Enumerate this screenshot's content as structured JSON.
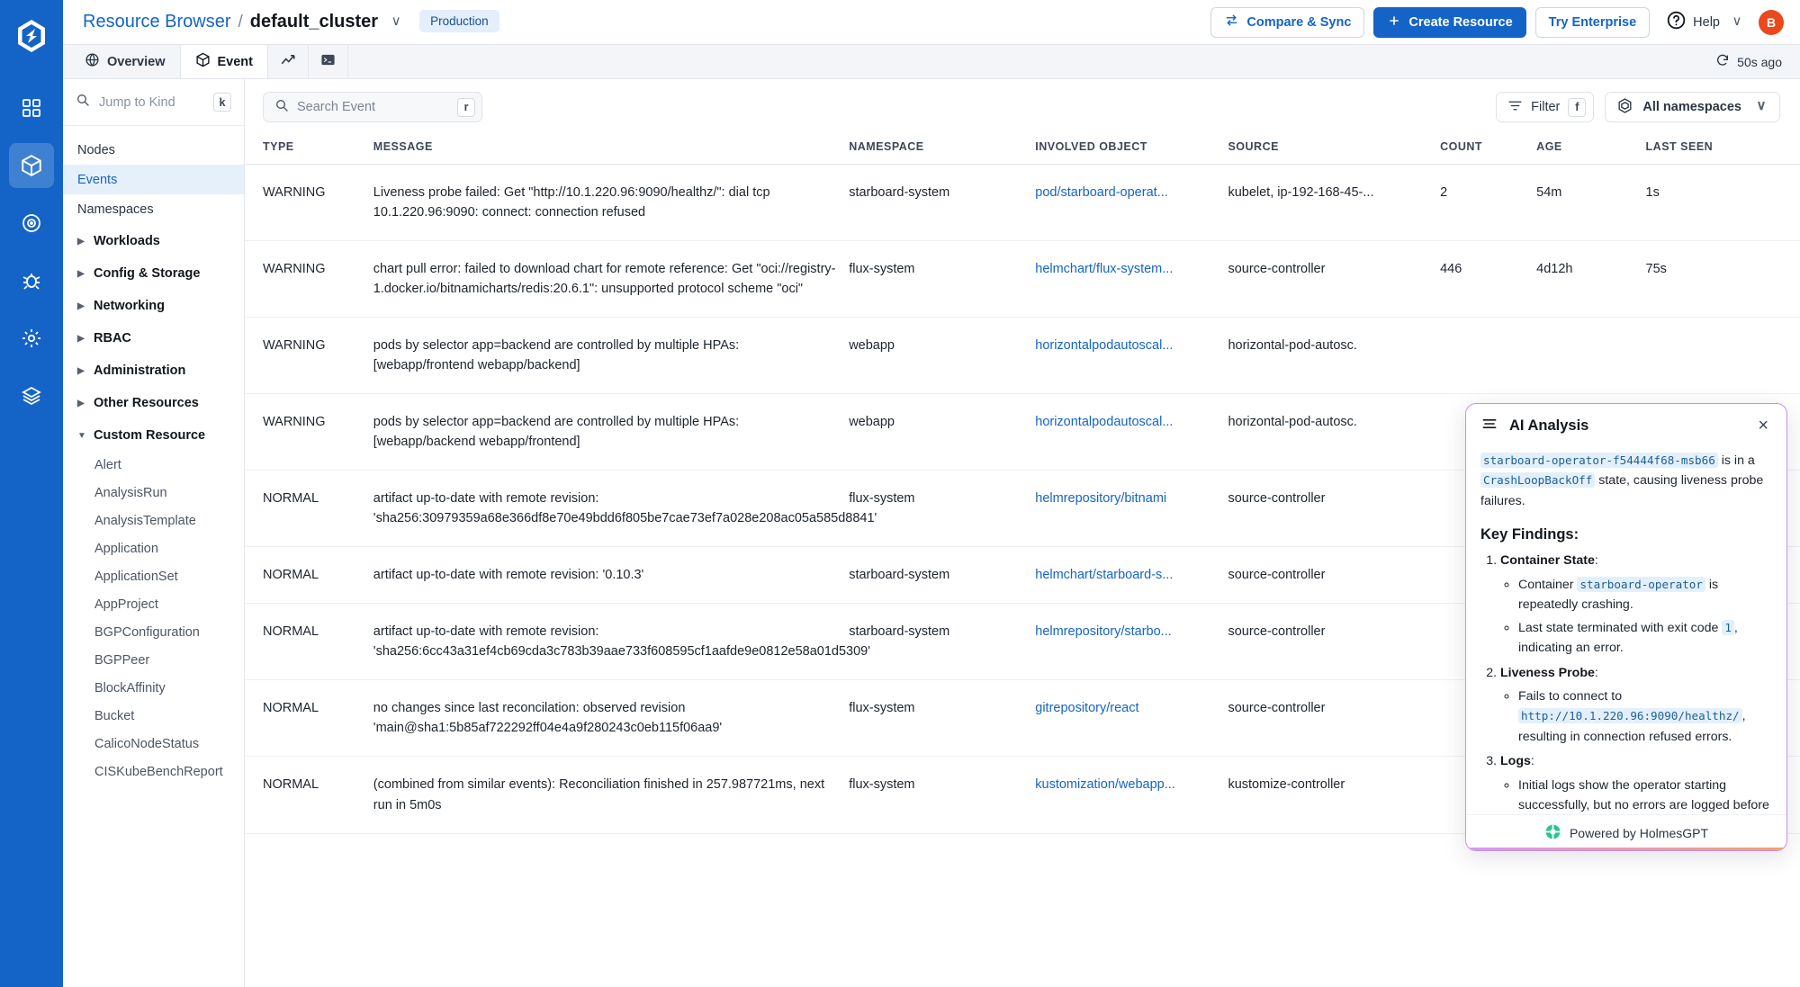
{
  "rail": {
    "logo_icon": "hexagon-logo-icon",
    "items": [
      {
        "name": "grid-dashboard-icon",
        "active": false
      },
      {
        "name": "cube-resources-icon",
        "active": true
      },
      {
        "name": "target-icon",
        "active": false
      },
      {
        "name": "bug-icon",
        "active": false
      },
      {
        "name": "settings-gear-icon",
        "active": false
      },
      {
        "name": "layers-icon",
        "active": false
      }
    ]
  },
  "header": {
    "breadcrumb_root": "Resource Browser",
    "breadcrumb_sep": "/",
    "breadcrumb_current": "default_cluster",
    "cluster_chevron": "∨",
    "env_badge": "Production",
    "compare_sync": "Compare & Sync",
    "create_resource": "Create Resource",
    "try_enterprise": "Try Enterprise",
    "help": "Help",
    "help_chevron": "∨",
    "avatar_initial": "B"
  },
  "tabs": [
    {
      "label": "Overview",
      "icon": "globe-icon",
      "active": false
    },
    {
      "label": "Event",
      "icon": "cube-icon",
      "active": true
    },
    {
      "label": "",
      "icon": "chart-line-icon",
      "active": false
    },
    {
      "label": "",
      "icon": "terminal-icon",
      "active": false
    }
  ],
  "refresh": {
    "icon": "refresh-icon",
    "label": "50s ago"
  },
  "sidebar": {
    "jump_placeholder": "Jump to Kind",
    "jump_shortcut": "k",
    "top_items": [
      {
        "label": "Nodes",
        "selected": false
      },
      {
        "label": "Events",
        "selected": true
      },
      {
        "label": "Namespaces",
        "selected": false
      }
    ],
    "groups": [
      {
        "label": "Workloads",
        "expanded": false
      },
      {
        "label": "Config & Storage",
        "expanded": false
      },
      {
        "label": "Networking",
        "expanded": false
      },
      {
        "label": "RBAC",
        "expanded": false
      },
      {
        "label": "Administration",
        "expanded": false
      },
      {
        "label": "Other Resources",
        "expanded": false
      },
      {
        "label": "Custom Resource",
        "expanded": true
      }
    ],
    "custom_resources": [
      "Alert",
      "AnalysisRun",
      "AnalysisTemplate",
      "Application",
      "ApplicationSet",
      "AppProject",
      "BGPConfiguration",
      "BGPPeer",
      "BlockAffinity",
      "Bucket",
      "CalicoNodeStatus",
      "CISKubeBenchReport"
    ]
  },
  "toolbar": {
    "search_placeholder": "Search Event",
    "search_shortcut": "r",
    "filter_label": "Filter",
    "filter_shortcut": "f",
    "namespace_label": "All namespaces",
    "namespace_chevron": "∨"
  },
  "table": {
    "columns": [
      "TYPE",
      "MESSAGE",
      "NAMESPACE",
      "INVOLVED OBJECT",
      "SOURCE",
      "COUNT",
      "AGE",
      "LAST SEEN"
    ],
    "rows": [
      {
        "type": "WARNING",
        "message": "Liveness probe failed: Get \"http://10.1.220.96:9090/healthz/\": dial tcp 10.1.220.96:9090: connect: connection refused",
        "namespace": "starboard-system",
        "object": "pod/starboard-operat...",
        "source": "kubelet, ip-192-168-45-...",
        "count": "2",
        "age": "54m",
        "last_seen": "1s"
      },
      {
        "type": "WARNING",
        "message": "chart pull error: failed to download chart for remote reference: Get \"oci://registry-1.docker.io/bitnamicharts/redis:20.6.1\": unsupported protocol scheme \"oci\"",
        "namespace": "flux-system",
        "object": "helmchart/flux-system...",
        "source": "source-controller",
        "count": "446",
        "age": "4d12h",
        "last_seen": "75s"
      },
      {
        "type": "WARNING",
        "message": "pods by selector app=backend are controlled by multiple HPAs: [webapp/frontend webapp/backend]",
        "namespace": "webapp",
        "object": "horizontalpodautoscal...",
        "source": "horizontal-pod-autosc.",
        "count": "",
        "age": "",
        "last_seen": ""
      },
      {
        "type": "WARNING",
        "message": "pods by selector app=backend are controlled by multiple HPAs: [webapp/backend webapp/frontend]",
        "namespace": "webapp",
        "object": "horizontalpodautoscal...",
        "source": "horizontal-pod-autosc.",
        "count": "",
        "age": "",
        "last_seen": ""
      },
      {
        "type": "NORMAL",
        "message": "artifact up-to-date with remote revision: 'sha256:30979359a68e366df8e70e49bdd6f805be7cae73ef7a028e208ac05a585d8841'",
        "namespace": "flux-system",
        "object": "helmrepository/bitnami",
        "source": "source-controller",
        "count": "",
        "age": "",
        "last_seen": ""
      },
      {
        "type": "NORMAL",
        "message": "artifact up-to-date with remote revision: '0.10.3'",
        "namespace": "starboard-system",
        "object": "helmchart/starboard-s...",
        "source": "source-controller",
        "count": "",
        "age": "",
        "last_seen": ""
      },
      {
        "type": "NORMAL",
        "message": "artifact up-to-date with remote revision: 'sha256:6cc43a31ef4cb69cda3c783b39aae733f608595cf1aafde9e0812e58a01d5309'",
        "namespace": "starboard-system",
        "object": "helmrepository/starbo...",
        "source": "source-controller",
        "count": "",
        "age": "",
        "last_seen": ""
      },
      {
        "type": "NORMAL",
        "message": "no changes since last reconcilation: observed revision 'main@sha1:5b85af722292ff04e4a9f280243c0eb115f06aa9'",
        "namespace": "flux-system",
        "object": "gitrepository/react",
        "source": "source-controller",
        "count": "",
        "age": "",
        "last_seen": ""
      },
      {
        "type": "NORMAL",
        "message": "(combined from similar events): Reconciliation finished in 257.987721ms, next run in 5m0s",
        "namespace": "flux-system",
        "object": "kustomization/webapp...",
        "source": "kustomize-controller",
        "count": "",
        "age": "",
        "last_seen": ""
      }
    ]
  },
  "ai_panel": {
    "menu_icon": "hamburger-lines-icon",
    "title": "AI Analysis",
    "close_icon": "×",
    "summary": {
      "pod_code": "starboard-operator-f54444f68-msb66",
      "mid_text": " is in a ",
      "state_code": "CrashLoopBackOff",
      "tail_text": " state, causing liveness probe failures."
    },
    "findings_heading": "Key Findings:",
    "findings": [
      {
        "title": "Container State",
        "bullets": [
          {
            "pre": "Container ",
            "code": "starboard-operator",
            "post": " is repeatedly crashing."
          },
          {
            "pre": "Last state terminated with exit code ",
            "code": "1",
            "post": ", indicating an error."
          }
        ]
      },
      {
        "title": "Liveness Probe",
        "bullets": [
          {
            "pre": "Fails to connect to ",
            "code": "http://10.1.220.96:9090/healthz/",
            "post": ", resulting in connection refused errors."
          }
        ]
      },
      {
        "title": "Logs",
        "bullets": [
          {
            "pre": "Initial logs show the operator starting successfully, but no errors are logged before the crash.",
            "code": "",
            "post": ""
          }
        ]
      }
    ],
    "footer_icon": "holmes-lifebuoy-icon",
    "footer_label": "Powered by HolmesGPT"
  },
  "colors": {
    "brand_blue": "#1464c8",
    "warning_red": "#e5332a",
    "panel_border_purple": "#c98fe8",
    "avatar_orange": "#e8491d",
    "badge_bg": "#e3effc"
  }
}
